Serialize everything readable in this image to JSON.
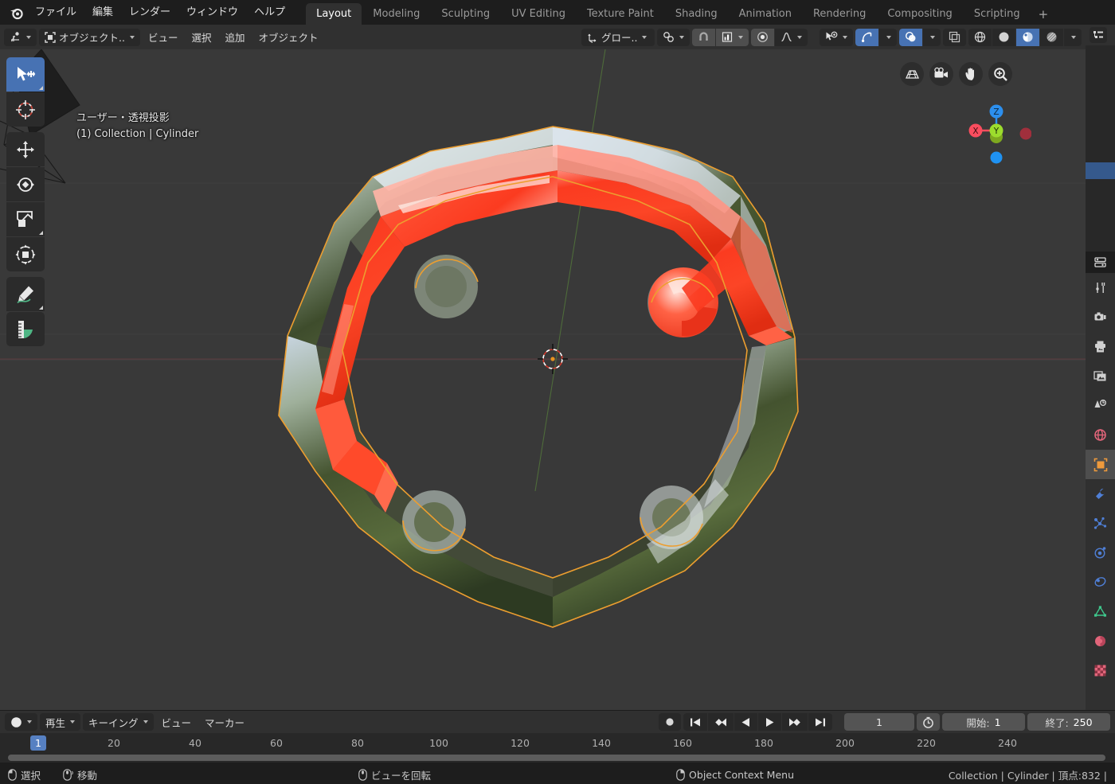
{
  "app": {
    "logo_icon": "blender-logo-icon",
    "menus": [
      "ファイル",
      "編集",
      "レンダー",
      "ウィンドウ",
      "ヘルプ"
    ],
    "workspaces": [
      {
        "label": "Layout",
        "active": true
      },
      {
        "label": "Modeling",
        "active": false
      },
      {
        "label": "Sculpting",
        "active": false
      },
      {
        "label": "UV Editing",
        "active": false
      },
      {
        "label": "Texture Paint",
        "active": false
      },
      {
        "label": "Shading",
        "active": false
      },
      {
        "label": "Animation",
        "active": false
      },
      {
        "label": "Rendering",
        "active": false
      },
      {
        "label": "Compositing",
        "active": false
      },
      {
        "label": "Scripting",
        "active": false
      }
    ],
    "add_workspace_label": "+"
  },
  "viewport_header": {
    "editor_type_icon": "editor-type-3dview-icon",
    "mode_icon": "object-mode-icon",
    "mode_label": "オブジェクト..",
    "menus": [
      "ビュー",
      "選択",
      "追加",
      "オブジェクト"
    ],
    "transform_orientation_icon": "orientation-axes-icon",
    "transform_orientation_label": "グロー..",
    "snap_magnet_icon": "magnet-icon",
    "snap_target_icon": "snap-increment-icon",
    "proportional_edit_icon": "proportional-editing-icon",
    "proportional_falloff_icon": "smooth-falloff-icon",
    "visibility_icon": "object-types-visibility-icon",
    "gizmo_icon": "gizmo-icon",
    "gizmo_active": true,
    "overlays_icon": "overlays-icon",
    "overlays_active": true,
    "xray_icon": "xray-toggle-icon",
    "shading_modes": [
      {
        "icon": "shading-wireframe-icon",
        "active": false
      },
      {
        "icon": "shading-solid-icon",
        "active": false
      },
      {
        "icon": "shading-material-preview-icon",
        "active": true
      },
      {
        "icon": "shading-rendered-icon",
        "active": false
      }
    ]
  },
  "viewport": {
    "view_info_line1": "ユーザー・透視投影",
    "view_info_line2": "(1) Collection | Cylinder",
    "tools": [
      {
        "name": "tweak-select-box-tool",
        "icon": "select-box-icon",
        "active": true
      },
      {
        "name": "cursor-tool",
        "icon": "3d-cursor-icon",
        "active": false
      },
      {
        "name": "move-tool",
        "icon": "move-arrows-icon",
        "active": false
      },
      {
        "name": "rotate-tool",
        "icon": "rotate-icon",
        "active": false
      },
      {
        "name": "scale-tool",
        "icon": "scale-icon",
        "active": false
      },
      {
        "name": "transform-tool",
        "icon": "transform-icon",
        "active": false
      },
      {
        "name": "annotate-tool",
        "icon": "annotate-pencil-icon",
        "active": false
      },
      {
        "name": "measure-tool",
        "icon": "measure-ruler-icon",
        "active": false
      }
    ],
    "nav_buttons": [
      {
        "name": "toggle-orthographic-button",
        "icon": "grid-perspective-icon"
      },
      {
        "name": "camera-view-button",
        "icon": "camera-icon"
      },
      {
        "name": "pan-view-button",
        "icon": "hand-icon"
      },
      {
        "name": "zoom-view-button",
        "icon": "magnifier-plus-icon"
      }
    ],
    "axis_gizmo": {
      "x_label": "X",
      "y_label": "Y",
      "z_label": "Z",
      "x_color": "#fa4d5e",
      "y_color": "#9cdc2d",
      "z_color": "#2c8fee"
    },
    "object": {
      "name": "Cylinder",
      "selection_outline_color": "#ed9e2f",
      "highlight_color": "#fb3b20",
      "material": "material-preview-environment-reflection"
    }
  },
  "outliner": {
    "editor_type_icon": "editor-type-outliner-icon",
    "rows": [
      {
        "selected": false
      },
      {
        "selected": false
      },
      {
        "selected": false
      },
      {
        "selected": false
      },
      {
        "selected": false
      },
      {
        "selected": false
      },
      {
        "selected": false
      },
      {
        "selected": true
      },
      {
        "selected": false
      },
      {
        "selected": false
      },
      {
        "selected": false
      },
      {
        "selected": false
      }
    ],
    "collapse_icon": "chevron-left-icon"
  },
  "properties": {
    "editor_type_icon": "editor-type-properties-icon",
    "tabs": [
      {
        "name": "tool-tab",
        "icon": "tool-wrench-screwdriver-icon",
        "color": "#d0d0d0",
        "active": false
      },
      {
        "name": "render-tab",
        "icon": "camera-back-icon",
        "color": "#d0d0d0",
        "active": false
      },
      {
        "name": "output-tab",
        "icon": "printer-icon",
        "color": "#d0d0d0",
        "active": false
      },
      {
        "name": "view-layer-tab",
        "icon": "images-stack-icon",
        "color": "#d0d0d0",
        "active": false
      },
      {
        "name": "scene-tab",
        "icon": "scene-cone-droplet-icon",
        "color": "#d0d0d0",
        "active": false
      },
      {
        "name": "world-tab",
        "icon": "world-globe-icon",
        "color": "#e2657a",
        "active": false
      },
      {
        "name": "object-tab",
        "icon": "object-square-icon",
        "color": "#ee9a3c",
        "active": true
      },
      {
        "name": "modifiers-tab",
        "icon": "wrench-icon",
        "color": "#4f7fd6",
        "active": false
      },
      {
        "name": "particles-tab",
        "icon": "particles-icon",
        "color": "#4f7fd6",
        "active": false
      },
      {
        "name": "physics-tab",
        "icon": "physics-orbit-icon",
        "color": "#4f7fd6",
        "active": false
      },
      {
        "name": "constraints-tab",
        "icon": "constraint-clamp-icon",
        "color": "#4f7fd6",
        "active": false
      },
      {
        "name": "object-data-tab",
        "icon": "mesh-data-triangle-icon",
        "color": "#3ec78c",
        "active": false
      },
      {
        "name": "material-tab",
        "icon": "material-sphere-icon",
        "color": "#e2657a",
        "active": false
      },
      {
        "name": "texture-tab",
        "icon": "texture-checker-icon",
        "color": "#e2657a",
        "active": false
      }
    ]
  },
  "timeline": {
    "editor_type_icon": "editor-type-timeline-icon",
    "menus": [
      {
        "label": "再生",
        "has_caret": true
      },
      {
        "label": "キーイング",
        "has_caret": true
      },
      {
        "label": "ビュー",
        "has_caret": false
      },
      {
        "label": "マーカー",
        "has_caret": false
      }
    ],
    "playback_buttons": [
      {
        "name": "auto-keying-button",
        "icon": "record-dot-icon"
      },
      {
        "name": "jump-to-start-button",
        "icon": "jump-start-icon"
      },
      {
        "name": "previous-keyframe-button",
        "icon": "prev-keyframe-icon"
      },
      {
        "name": "play-reverse-button",
        "icon": "play-reverse-icon"
      },
      {
        "name": "play-button",
        "icon": "play-icon"
      },
      {
        "name": "next-keyframe-button",
        "icon": "next-keyframe-icon"
      },
      {
        "name": "jump-to-end-button",
        "icon": "jump-end-icon"
      }
    ],
    "current_frame": "1",
    "use_preview_range_icon": "stopwatch-icon",
    "start_label": "開始:",
    "start_value": "1",
    "end_label": "終了:",
    "end_value": "250",
    "ruler_ticks": [
      "20",
      "40",
      "60",
      "80",
      "100",
      "120",
      "140",
      "160",
      "180",
      "200",
      "220",
      "240"
    ],
    "playhead_label": "1"
  },
  "status_bar": {
    "items": [
      {
        "icon": "mouse-left-button-icon",
        "label": "選択"
      },
      {
        "icon": "mouse-middle-drag-icon",
        "label": "移動"
      },
      {
        "icon": "mouse-middle-button-icon",
        "label": "ビューを回転"
      },
      {
        "icon": "mouse-right-button-icon",
        "label": "Object Context Menu"
      }
    ],
    "scene_stats": "Collection | Cylinder | 頂点:832 |"
  }
}
